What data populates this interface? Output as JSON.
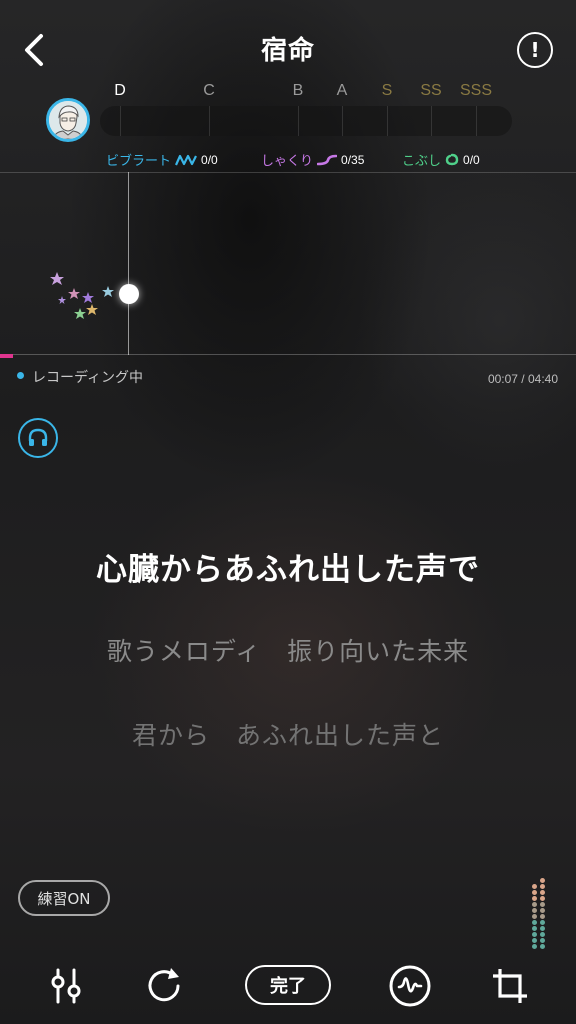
{
  "header": {
    "title": "宿命",
    "back_icon": "chevron-left-icon",
    "info_icon": "exclamation-circle-icon"
  },
  "rank": {
    "labels": [
      {
        "text": "D",
        "color": "#ffffff"
      },
      {
        "text": "C",
        "color": "#9a9a9a"
      },
      {
        "text": "B",
        "color": "#9a9a9a"
      },
      {
        "text": "A",
        "color": "#9a9a9a"
      },
      {
        "text": "S",
        "color": "#8a7a43"
      },
      {
        "text": "SS",
        "color": "#8a7a43"
      },
      {
        "text": "SSS",
        "color": "#8a7a43"
      }
    ]
  },
  "techniques": {
    "vibrato": {
      "label": "ビブラート",
      "count": "0/0",
      "color": "#3ab6e8"
    },
    "shakuri": {
      "label": "しゃくり",
      "count": "0/35",
      "color": "#c678e6"
    },
    "kobushi": {
      "label": "こぶし",
      "count": "0/0",
      "color": "#4fd08a"
    }
  },
  "status": {
    "recording_label": "レコーディング中",
    "time": "00:07 / 04:40",
    "progress_fraction": 0.025
  },
  "lyrics": {
    "current": "心臓からあふれ出した声で",
    "next": "歌うメロディ　振り向いた未来",
    "next2": "君から　あふれ出した声と"
  },
  "practice": {
    "label": "練習ON"
  },
  "toolbar": {
    "mixer_icon": "sliders-icon",
    "restart_icon": "restart-icon",
    "done_label": "完了",
    "pitch_icon": "waveform-icon",
    "crop_icon": "crop-icon"
  },
  "colors": {
    "accent": "#3ab6e8",
    "progress": "#e0358f"
  }
}
